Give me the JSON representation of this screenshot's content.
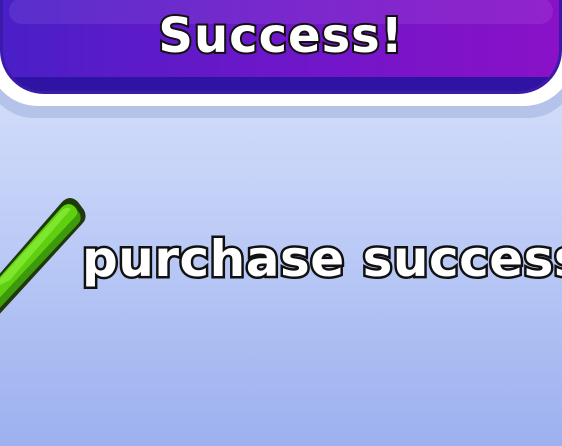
{
  "dialog": {
    "title": "Success!",
    "message": "purchase successf",
    "status_icon": "checkmark-icon",
    "colors": {
      "header": "#6b17c9",
      "checkmark": "#5fd00f",
      "background": "#c6d3f8"
    }
  }
}
